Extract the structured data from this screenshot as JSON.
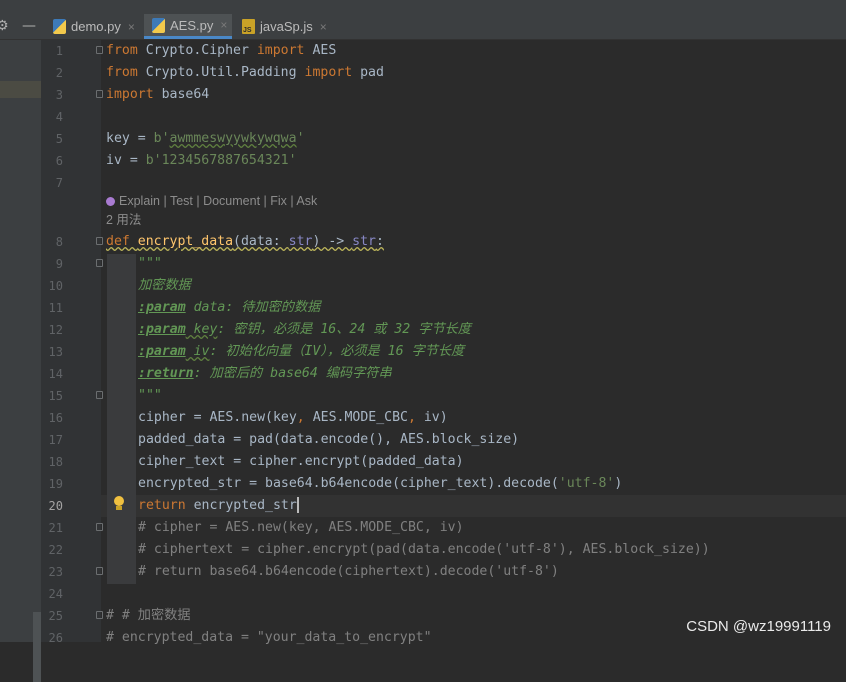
{
  "tabs": [
    {
      "label": "demo.py",
      "icon": "python-file-icon",
      "active": false
    },
    {
      "label": "AES.py",
      "icon": "python-file-icon",
      "active": true
    },
    {
      "label": "javaSp.js",
      "icon": "js-file-icon",
      "active": false
    }
  ],
  "tab_close_glyph": "×",
  "toolbar": {
    "settings_glyph": "⚙",
    "minimize_glyph": "—"
  },
  "line_numbers": [
    "1",
    "2",
    "3",
    "4",
    "5",
    "6",
    "7",
    "8",
    "9",
    "10",
    "11",
    "12",
    "13",
    "14",
    "15",
    "16",
    "17",
    "18",
    "19",
    "20",
    "21",
    "22",
    "23",
    "24",
    "25",
    "26"
  ],
  "current_line": "20",
  "code": {
    "l1": {
      "a": "from ",
      "b": "Crypto.Cipher ",
      "c": "import ",
      "d": "AES"
    },
    "l2": {
      "a": "from ",
      "b": "Crypto.Util.Padding ",
      "c": "import ",
      "d": "pad"
    },
    "l3": {
      "a": "import ",
      "b": "base64"
    },
    "l5": {
      "a": "key = ",
      "b": "b'",
      "c": "awmmeswyywkywqwa",
      "d": "'"
    },
    "l6": {
      "a": "iv = ",
      "b": "b'1234567887654321'"
    },
    "hint_ai": "Explain | Test | Document | Fix | Ask",
    "hint_usages": "2 用法",
    "l8": {
      "def": "def ",
      "name": "encrypt_data",
      "p1": "(data: ",
      "t1": "str",
      "p2": ") -> ",
      "t2": "str",
      "p3": ":"
    },
    "l9": "\"\"\"",
    "l10": "加密数据",
    "l11": {
      "tag": ":param",
      "name": " data",
      "rest": ": 待加密的数据"
    },
    "l12": {
      "tag": ":param",
      "name": " key",
      "rest": ": 密钥，必须是 16、24 或 32 字节长度"
    },
    "l13": {
      "tag": ":param",
      "name": " iv",
      "rest": ": 初始化向量（IV），必须是 16 字节长度"
    },
    "l14": {
      "tag": ":return",
      "rest": ": 加密后的 base64 编码字符串"
    },
    "l15": "\"\"\"",
    "l16": {
      "a": "cipher = AES.new(key",
      ",": ", ",
      "b": "AES.MODE_CBC",
      ",2": ", ",
      "c": "iv)"
    },
    "l17": "padded_data = pad(data.encode(), AES.block_size)",
    "l18": "cipher_text = cipher.encrypt(padded_data)",
    "l19": {
      "a": "encrypted_str = base64.b64encode(cipher_text).decode(",
      "b": "'utf-8'",
      "c": ")"
    },
    "l20": {
      "kw": "return ",
      "rest": "encrypted_str"
    },
    "l21": "# cipher = AES.new(key, AES.MODE_CBC, iv)",
    "l22": "# ciphertext = cipher.encrypt(pad(data.encode('utf-8'), AES.block_size))",
    "l23": "# return base64.b64encode(ciphertext).decode('utf-8')",
    "l25": "# # 加密数据",
    "l26": "# encrypted_data = \"your_data_to_encrypt\""
  },
  "watermark": "CSDN @wz19991119"
}
